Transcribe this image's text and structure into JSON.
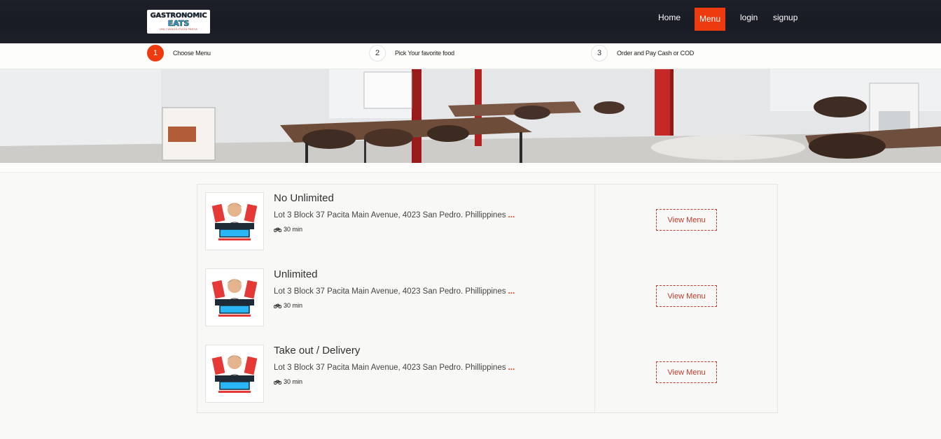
{
  "brand": {
    "logo_line1": "GASTRONOMIC",
    "logo_line2": "EATS",
    "logo_tagline": "UNLI WINGS PIZZA PASTA"
  },
  "nav": {
    "items": [
      {
        "label": "Home",
        "active": false
      },
      {
        "label": "Menu",
        "active": true
      },
      {
        "label": "login",
        "active": false
      },
      {
        "label": "signup",
        "active": false
      }
    ]
  },
  "steps": [
    {
      "num": "1",
      "label": "Choose Menu",
      "active": true
    },
    {
      "num": "2",
      "label": "Pick Your favorite food",
      "active": false
    },
    {
      "num": "3",
      "label": "Order and Pay Cash or COD",
      "active": false
    }
  ],
  "restaurants": [
    {
      "title": "No Unlimited",
      "address": "Lot 3 Block 37 Pacita Main Avenue, 4023 San Pedro. Phillippines",
      "more": "...",
      "time": "30 min",
      "button": "View Menu"
    },
    {
      "title": "Unlimited",
      "address": "Lot 3 Block 37 Pacita Main Avenue, 4023 San Pedro. Phillippines",
      "more": "...",
      "time": "30 min",
      "button": "View Menu"
    },
    {
      "title": "Take out / Delivery",
      "address": "Lot 3 Block 37 Pacita Main Avenue, 4023 San Pedro. Phillippines",
      "more": "...",
      "time": "30 min",
      "button": "View Menu"
    }
  ],
  "colors": {
    "navbar": "#1c1f27",
    "accent": "#ee3a0f",
    "button_text": "#c0392b"
  },
  "icons": {
    "time": "bicycle-icon",
    "thumb": "restaurant-logo"
  }
}
